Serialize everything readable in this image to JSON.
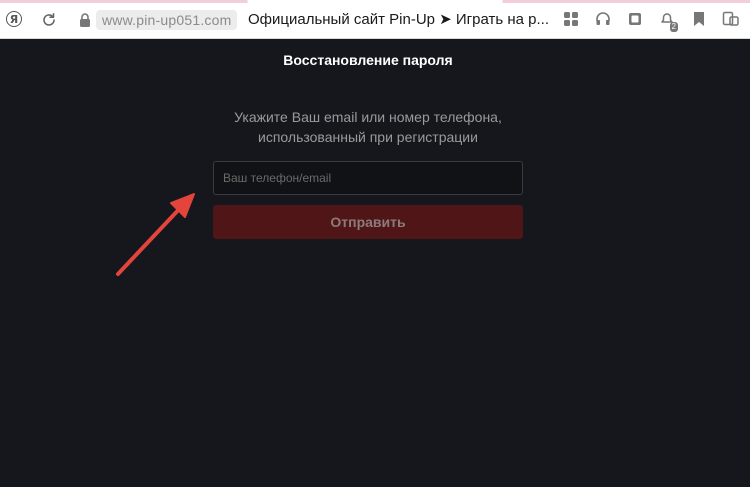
{
  "browser": {
    "logo_text": "Я",
    "url": "www.pin-up051.com",
    "tab_title": "Официальный сайт Pin-Up ➤ Играть на р...",
    "notification_badge": "2"
  },
  "page": {
    "heading": "Восстановление пароля",
    "hint_line1": "Укажите Ваш email или номер телефона,",
    "hint_line2": "использованный при регистрации",
    "input_placeholder": "Ваш телефон/email",
    "submit_label": "Отправить"
  },
  "icons": [
    "yandex-icon",
    "refresh-icon",
    "lock-icon",
    "apps-icon",
    "headphones-icon",
    "collections-icon",
    "notifications-icon",
    "bookmark-icon",
    "extensions-icon",
    "red-arrow-annotation-icon"
  ],
  "colors": {
    "background": "#16171d",
    "submit_button": "#4f1517",
    "arrow": "#e3443c"
  }
}
